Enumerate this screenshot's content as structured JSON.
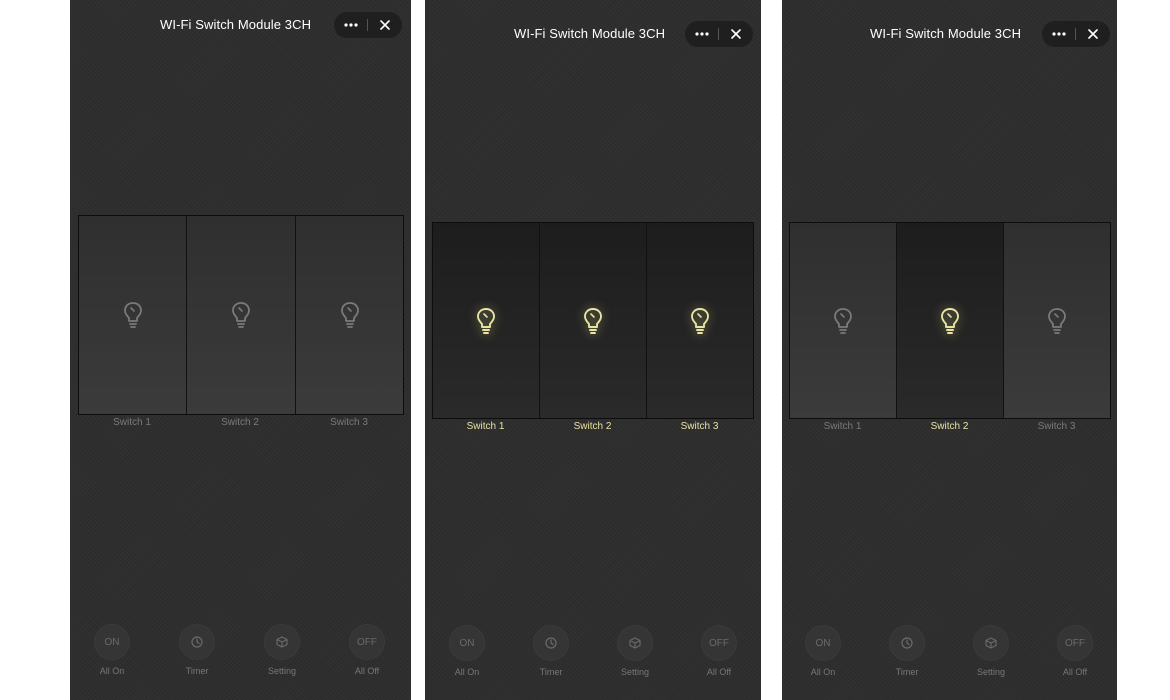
{
  "colors": {
    "background": "#2e2e2e",
    "bulb_on": "#e8e3a2",
    "bulb_off": "#7a7a7a"
  },
  "screens": [
    {
      "title": "WI-Fi Switch Module 3CH",
      "switches": [
        {
          "label": "Switch 1",
          "state": "off",
          "icon": "bulb-icon"
        },
        {
          "label": "Switch 2",
          "state": "off",
          "icon": "bulb-icon"
        },
        {
          "label": "Switch 3",
          "state": "off",
          "icon": "bulb-icon"
        }
      ]
    },
    {
      "title": "WI-Fi Switch Module 3CH",
      "switches": [
        {
          "label": "Switch 1",
          "state": "on",
          "icon": "bulb-icon"
        },
        {
          "label": "Switch 2",
          "state": "on",
          "icon": "bulb-icon"
        },
        {
          "label": "Switch 3",
          "state": "on",
          "icon": "bulb-icon"
        }
      ]
    },
    {
      "title": "WI-Fi Switch Module 3CH",
      "switches": [
        {
          "label": "Switch 1",
          "state": "off",
          "icon": "bulb-icon"
        },
        {
          "label": "Switch 2",
          "state": "on",
          "icon": "bulb-icon"
        },
        {
          "label": "Switch 3",
          "state": "off",
          "icon": "bulb-icon"
        }
      ]
    }
  ],
  "bottom_bar": {
    "all_on": {
      "icon_text": "ON",
      "label": "All On"
    },
    "timer": {
      "icon": "clock-icon",
      "label": "Timer"
    },
    "setting": {
      "icon": "cube-icon",
      "label": "Setting"
    },
    "all_off": {
      "icon_text": "OFF",
      "label": "All Off"
    }
  },
  "capsule": {
    "more_icon": "more-icon",
    "close_icon": "close-icon"
  }
}
